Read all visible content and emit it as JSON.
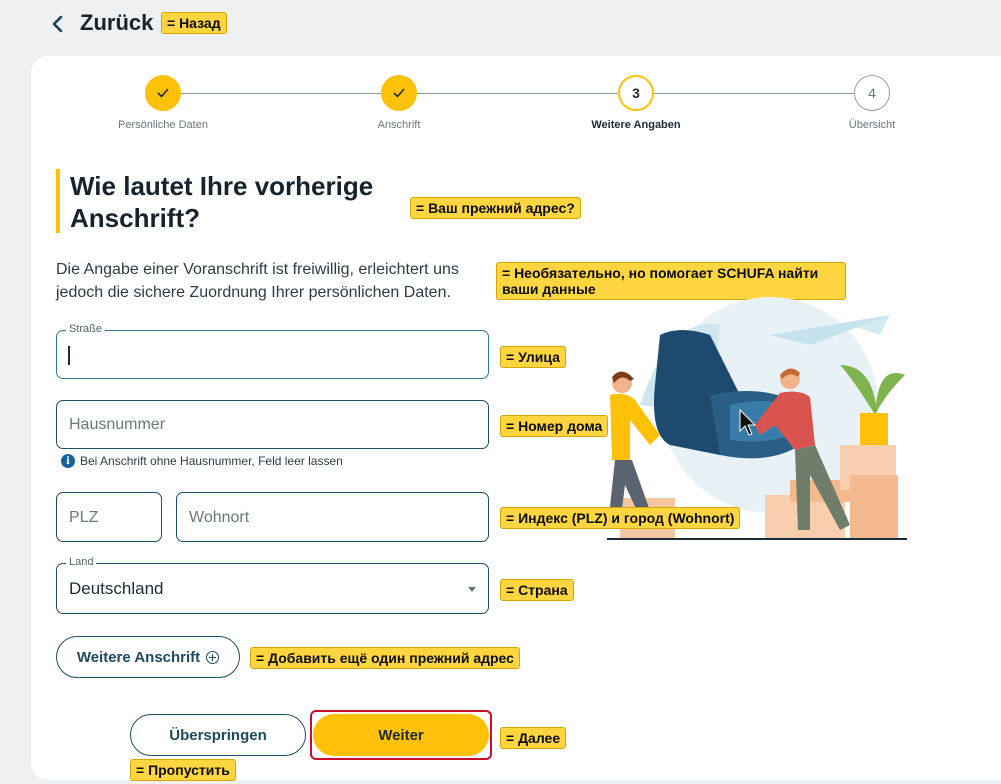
{
  "header": {
    "back_label": "Zurück",
    "back_tag": "= Назад"
  },
  "stepper": {
    "steps": [
      {
        "label": "Persönliche Daten",
        "number": "✓",
        "state": "done"
      },
      {
        "label": "Anschrift",
        "number": "✓",
        "state": "done"
      },
      {
        "label": "Weitere Angaben",
        "number": "3",
        "state": "active"
      },
      {
        "label": "Übersicht",
        "number": "4",
        "state": "todo"
      }
    ]
  },
  "main": {
    "heading_line1": "Wie lautet Ihre vorherige",
    "heading_line2": "Anschrift?",
    "heading_tag": "= Ваш прежний адрес?",
    "intro": "Die Angabe einer Voranschrift ist freiwillig, erleichtert uns jedoch die sichere Zuordnung Ihrer persönlichen Daten.",
    "intro_tag": "= Необязательно, но помогает SCHUFA найти ваши данные"
  },
  "form": {
    "street": {
      "legend": "Straße",
      "value": "",
      "tag": "= Улица"
    },
    "house_number": {
      "placeholder": "Hausnummer",
      "tag": "= Номер дома",
      "hint": "Bei Anschrift ohne Hausnummer, Feld leer lassen",
      "hint_icon": "info-icon"
    },
    "plz": {
      "placeholder": "PLZ"
    },
    "city": {
      "placeholder": "Wohnort",
      "tag": "= Индекс (PLZ) и город (Wohnort)"
    },
    "country": {
      "legend": "Land",
      "value": "Deutschland",
      "tag": "= Страна"
    },
    "add_address": {
      "label": "Weitere Anschrift",
      "icon": "plus-circle-icon",
      "tag": "= Добавить ещё один прежний адрес"
    }
  },
  "actions": {
    "skip_label": "Überspringen",
    "skip_tag": "= Пропустить",
    "next_label": "Weiter",
    "next_tag": "= Далее"
  },
  "colors": {
    "accent": "#ffc107",
    "primary_dark": "#1d5066",
    "highlight_frame": "#c8102e",
    "tag_bg": "#ffd640"
  }
}
